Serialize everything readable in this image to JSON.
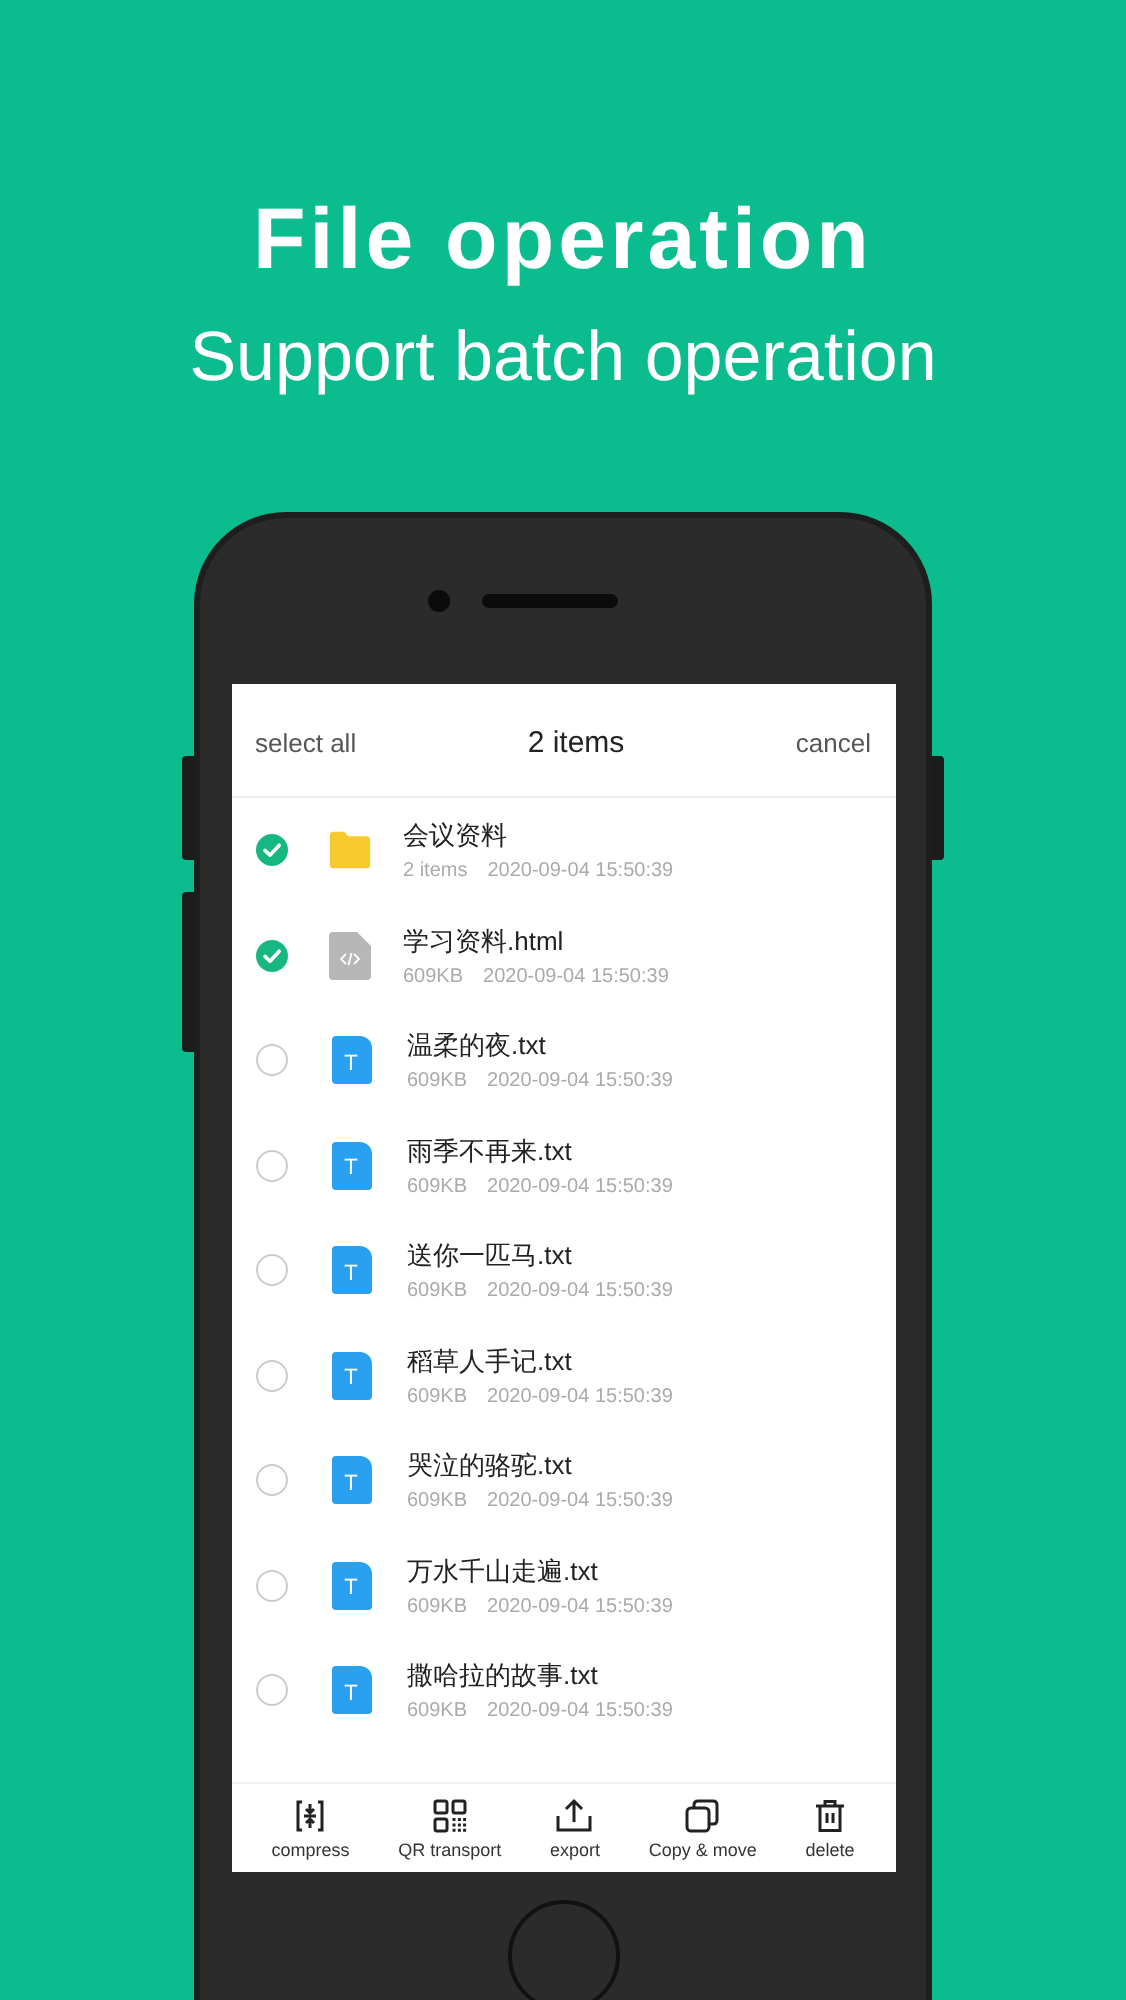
{
  "headline": "File operation",
  "subheadline": "Support batch operation",
  "header": {
    "left": "select all",
    "title": "2 items",
    "right": "cancel"
  },
  "files": [
    {
      "kind": "folder",
      "name": "会议资料",
      "info": "2 items",
      "date": "2020-09-04 15:50:39",
      "selected": true
    },
    {
      "kind": "html",
      "name": "学习资料.html",
      "info": "609KB",
      "date": "2020-09-04 15:50:39",
      "selected": true
    },
    {
      "kind": "txt",
      "letter": "T",
      "name": "温柔的夜.txt",
      "info": "609KB",
      "date": "2020-09-04 15:50:39",
      "selected": false
    },
    {
      "kind": "txt",
      "letter": "T",
      "name": "雨季不再来.txt",
      "info": "609KB",
      "date": "2020-09-04 15:50:39",
      "selected": false
    },
    {
      "kind": "txt",
      "letter": "T",
      "name": "送你一匹马.txt",
      "info": "609KB",
      "date": "2020-09-04 15:50:39",
      "selected": false
    },
    {
      "kind": "txt",
      "letter": "T",
      "name": "稻草人手记.txt",
      "info": "609KB",
      "date": "2020-09-04 15:50:39",
      "selected": false
    },
    {
      "kind": "txt",
      "letter": "T",
      "name": "哭泣的骆驼.txt",
      "info": "609KB",
      "date": "2020-09-04 15:50:39",
      "selected": false
    },
    {
      "kind": "txt",
      "letter": "T",
      "name": "万水千山走遍.txt",
      "info": "609KB",
      "date": "2020-09-04 15:50:39",
      "selected": false
    },
    {
      "kind": "txt",
      "letter": "T",
      "name": "撒哈拉的故事.txt",
      "info": "609KB",
      "date": "2020-09-04 15:50:39",
      "selected": false
    }
  ],
  "toolbar": [
    {
      "kind": "compress",
      "label": "compress"
    },
    {
      "kind": "qr",
      "label": "QR transport"
    },
    {
      "kind": "export",
      "label": "export"
    },
    {
      "kind": "copy",
      "label": "Copy & move"
    },
    {
      "kind": "delete",
      "label": "delete"
    }
  ]
}
